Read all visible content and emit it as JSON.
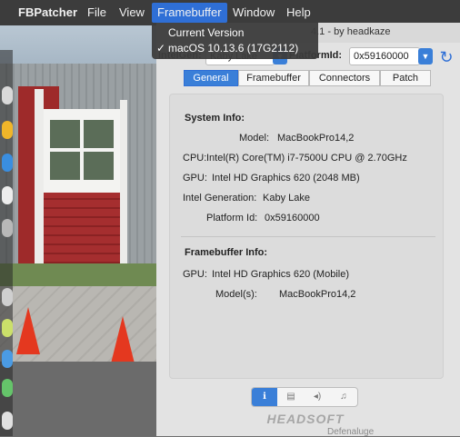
{
  "menubar": {
    "items": [
      "FBPatcher",
      "File",
      "View",
      "Framebuffer",
      "Window",
      "Help"
    ],
    "active": "Framebuffer"
  },
  "dropdown": {
    "header": "Current Version",
    "items": [
      {
        "label": "macOS 10.13.6 (17G2112)",
        "checked": true,
        "check_mark": "✓"
      }
    ]
  },
  "window": {
    "title_fragment": "4.1 - by headkaze",
    "intelgen_label": "IntelGen:",
    "intelgen_value": "Kaby Lake",
    "platformid_label": "PlatformId:",
    "platformid_value": "0x59160000",
    "refresh_icon": "refresh-icon",
    "accent_color": "#3a7fd8"
  },
  "tabs": [
    {
      "label": "General",
      "active": true
    },
    {
      "label": "Framebuffer",
      "active": false
    },
    {
      "label": "Connectors",
      "active": false
    },
    {
      "label": "Patch",
      "active": false
    }
  ],
  "system_info": {
    "title": "System Info:",
    "rows": [
      {
        "label": "Model:",
        "value": "MacBookPro14,2"
      },
      {
        "label": "CPU:",
        "value": "Intel(R) Core(TM) i7-7500U CPU @ 2.70GHz"
      },
      {
        "label": "GPU:",
        "value": "Intel HD Graphics 620 (2048 MB)"
      },
      {
        "label": "Intel Generation:",
        "value": "Kaby Lake"
      },
      {
        "label": "Platform Id:",
        "value": "0x59160000"
      }
    ]
  },
  "framebuffer_info": {
    "title": "Framebuffer Info:",
    "rows": [
      {
        "label": "GPU:",
        "value": "Intel HD Graphics 620 (Mobile)"
      },
      {
        "label": "Model(s):",
        "value": "MacBookPro14,2"
      }
    ]
  },
  "footer": {
    "segments": [
      "info-icon",
      "list-icon",
      "speaker-icon",
      "music-icon"
    ],
    "segment_glyphs": [
      "ℹ",
      "▤",
      "◂)",
      "♫"
    ],
    "brand": "HEADSOFT"
  },
  "bottom_note": "Defenaluge"
}
